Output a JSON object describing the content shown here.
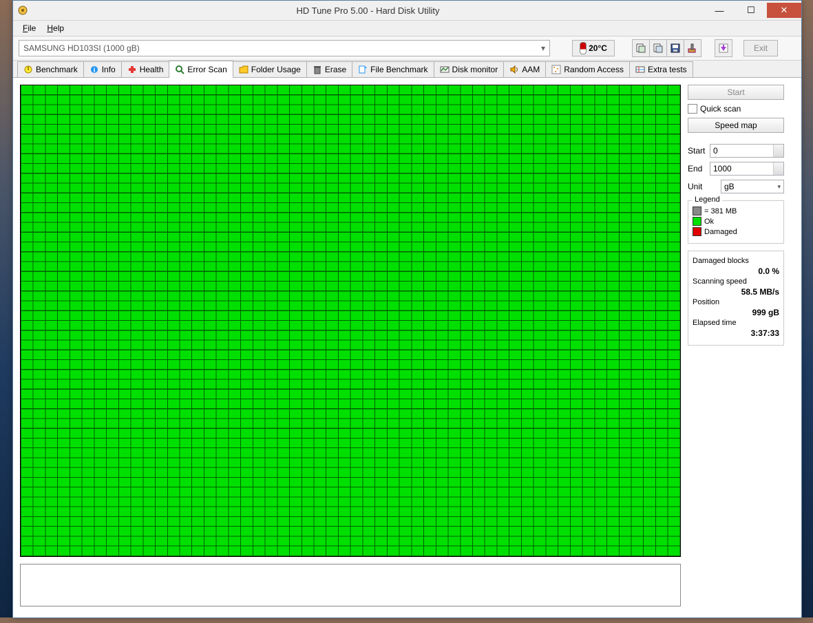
{
  "window": {
    "title": "HD Tune Pro 5.00 - Hard Disk Utility"
  },
  "menu": {
    "file": "File",
    "help": "Help"
  },
  "toolbar": {
    "drive": "SAMSUNG HD103SI (1000 gB)",
    "temp": "20°C",
    "exit": "Exit"
  },
  "tabs": {
    "benchmark": "Benchmark",
    "info": "Info",
    "health": "Health",
    "errorscan": "Error Scan",
    "folderusage": "Folder Usage",
    "erase": "Erase",
    "filebenchmark": "File Benchmark",
    "diskmonitor": "Disk monitor",
    "aam": "AAM",
    "randomaccess": "Random Access",
    "extratests": "Extra tests"
  },
  "panel": {
    "start": "Start",
    "quickscan": "Quick scan",
    "speedmap": "Speed map",
    "start_lbl": "Start",
    "start_val": "0",
    "end_lbl": "End",
    "end_val": "1000",
    "unit_lbl": "Unit",
    "unit_val": "gB"
  },
  "legend": {
    "title": "Legend",
    "block": "= 381 MB",
    "ok": "Ok",
    "damaged": "Damaged"
  },
  "stats": {
    "damaged_lbl": "Damaged blocks",
    "damaged_val": "0.0 %",
    "speed_lbl": "Scanning speed",
    "speed_val": "58.5 MB/s",
    "pos_lbl": "Position",
    "pos_val": "999 gB",
    "elapsed_lbl": "Elapsed time",
    "elapsed_val": "3:37:33"
  }
}
